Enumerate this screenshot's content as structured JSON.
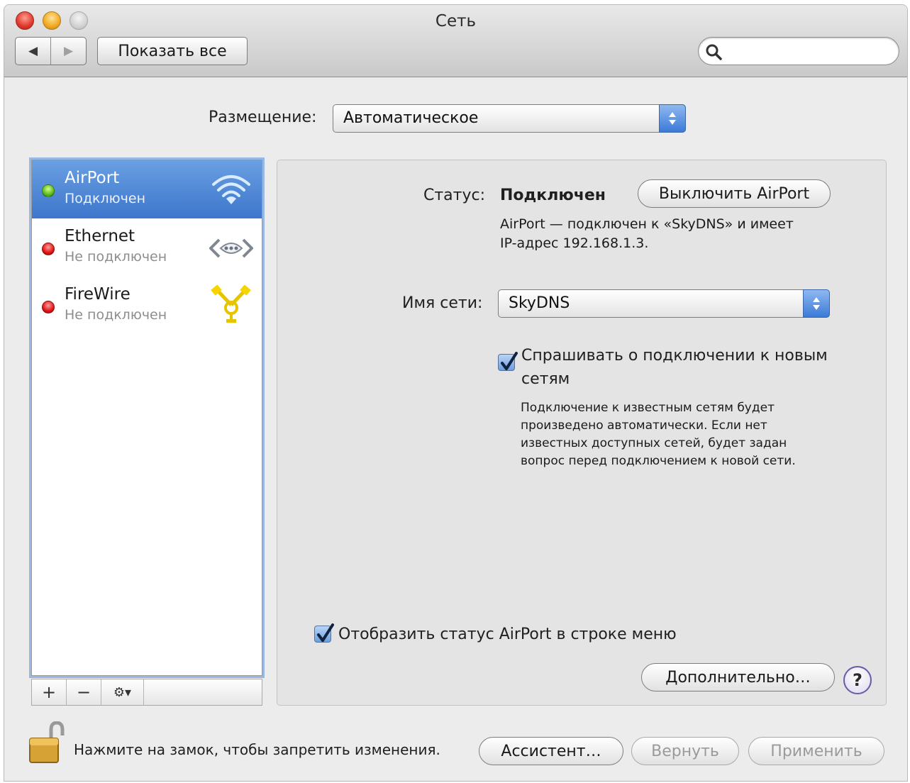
{
  "window": {
    "title": "Сеть"
  },
  "toolbar": {
    "back_glyph": "◀",
    "forward_glyph": "▶",
    "show_all_label": "Показать все",
    "search_placeholder": ""
  },
  "location": {
    "label": "Размещение:",
    "value": "Автоматическое"
  },
  "services": [
    {
      "name": "AirPort",
      "status": "Подключен",
      "indicator": "green",
      "icon": "wifi-icon",
      "selected": true
    },
    {
      "name": "Ethernet",
      "status": "Не подключен",
      "indicator": "red",
      "icon": "ethernet-icon",
      "selected": false
    },
    {
      "name": "FireWire",
      "status": "Не подключен",
      "indicator": "red",
      "icon": "firewire-icon",
      "selected": false
    }
  ],
  "sidebar_toolbar": {
    "add": "+",
    "remove": "−",
    "gear": "⚙▾"
  },
  "detail": {
    "status_label": "Статус:",
    "status_value": "Подключен",
    "turn_off_label": "Выключить AirPort",
    "status_desc_line1": "AirPort — подключен к «SkyDNS» и имеет",
    "status_desc_line2": "IP-адрес 192.168.1.3.",
    "network_name_label": "Имя сети:",
    "network_name_value": "SkyDNS",
    "ask_join_line1": "Спрашивать о подключении к новым",
    "ask_join_line2": "сетям",
    "ask_join_checked": true,
    "ask_join_help_line1": "Подключение к известным сетям будет",
    "ask_join_help_line2": "произведено автоматически. Если нет",
    "ask_join_help_line3": "известных доступных сетей, будет задан",
    "ask_join_help_line4": "вопрос перед подключением к новой сети.",
    "show_status_label": "Отобразить статус AirPort в строке меню",
    "show_status_checked": true,
    "advanced_label": "Дополнительно…",
    "help_glyph": "?"
  },
  "footer": {
    "lock_text": "Нажмите на замок, чтобы запретить изменения.",
    "assistant_label": "Ассистент…",
    "revert_label": "Вернуть",
    "apply_label": "Применить"
  },
  "colors": {
    "selection": "#3d76cc",
    "connected": "#5dbb1b",
    "disconnected": "#e01414",
    "popup_arrow": "#3c7ad8"
  }
}
